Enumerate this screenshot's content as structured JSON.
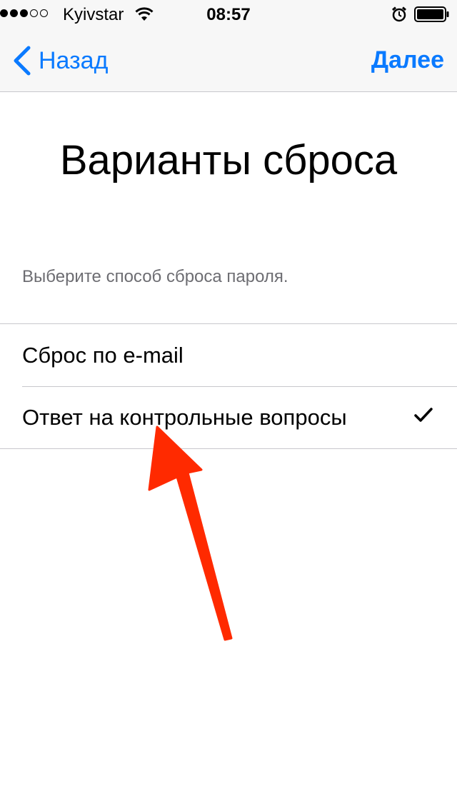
{
  "status_bar": {
    "carrier": "Kyivstar",
    "time": "08:57",
    "signal_strength": 3,
    "signal_max": 5
  },
  "nav": {
    "back_label": "Назад",
    "next_label": "Далее",
    "accent_color": "#0a7aff"
  },
  "page": {
    "title": "Варианты сброса",
    "subtitle": "Выберите способ сброса пароля."
  },
  "options": [
    {
      "label": "Сброс по e-mail",
      "selected": false
    },
    {
      "label": "Ответ на контрольные вопросы",
      "selected": true
    }
  ],
  "annotation": {
    "color": "#ff2a00",
    "icon": "arrow-up-icon"
  }
}
